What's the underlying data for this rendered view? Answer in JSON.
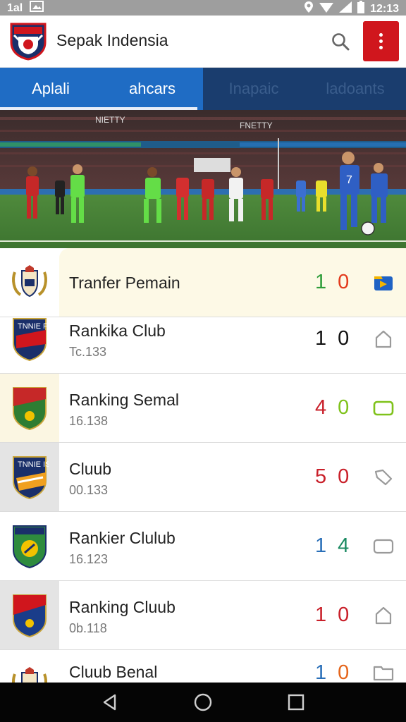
{
  "status_bar": {
    "signal": "1al",
    "time": "12:13"
  },
  "app": {
    "title": "Sepak Indensia"
  },
  "tabs": [
    {
      "label": "Aplali",
      "active": true
    },
    {
      "label": "ahcars",
      "active": true
    },
    {
      "label": "Inapaic",
      "active": false
    },
    {
      "label": "ladoants",
      "active": false
    }
  ],
  "hero": {
    "banner_text_1": "NIETTY",
    "banner_text_2": "FNETTY",
    "player_number": "7"
  },
  "list": {
    "items": [
      {
        "name": "Tranfer Pemain",
        "sub": "",
        "score_home": "1",
        "score_away": "0",
        "home_color": "#2e9d3a",
        "away_color": "#e33a1c",
        "icon": "badge-icon",
        "icon_color": "#1f62c4"
      },
      {
        "name": "Rankika Club",
        "sub": "Tc.133",
        "score_home": "1",
        "score_away": "0",
        "home_color": "#111111",
        "away_color": "#111111",
        "icon": "home-icon",
        "icon_color": "#9a9a9a"
      },
      {
        "name": "Ranking Semal",
        "sub": "16.138",
        "score_home": "4",
        "score_away": "0",
        "home_color": "#c9202a",
        "away_color": "#7fc21b",
        "icon": "tag-icon",
        "icon_color": "#7fc21b"
      },
      {
        "name": "Cluub",
        "sub": "00.133",
        "score_home": "5",
        "score_away": "0",
        "home_color": "#c9202a",
        "away_color": "#c9202a",
        "icon": "label-icon",
        "icon_color": "#9a9a9a"
      },
      {
        "name": "Rankier Clulub",
        "sub": "16.123",
        "score_home": "1",
        "score_away": "4",
        "home_color": "#2a6fb8",
        "away_color": "#1b8a62",
        "icon": "tag-icon",
        "icon_color": "#9a9a9a"
      },
      {
        "name": "Ranking Cluub",
        "sub": "0b.118",
        "score_home": "1",
        "score_away": "0",
        "home_color": "#c9202a",
        "away_color": "#c9202a",
        "icon": "home-icon",
        "icon_color": "#9a9a9a"
      },
      {
        "name": "Cluub Benal",
        "sub": "",
        "score_home": "1",
        "score_away": "0",
        "home_color": "#2a6fb8",
        "away_color": "#e5651b",
        "icon": "folder-icon",
        "icon_color": "#9a9a9a"
      }
    ]
  },
  "crests": [
    {
      "text": ""
    },
    {
      "text": "TNNIE FC"
    },
    {
      "text": ""
    },
    {
      "text": "TNNIE IS"
    },
    {
      "text": ""
    },
    {
      "text": ""
    },
    {
      "text": ""
    }
  ]
}
